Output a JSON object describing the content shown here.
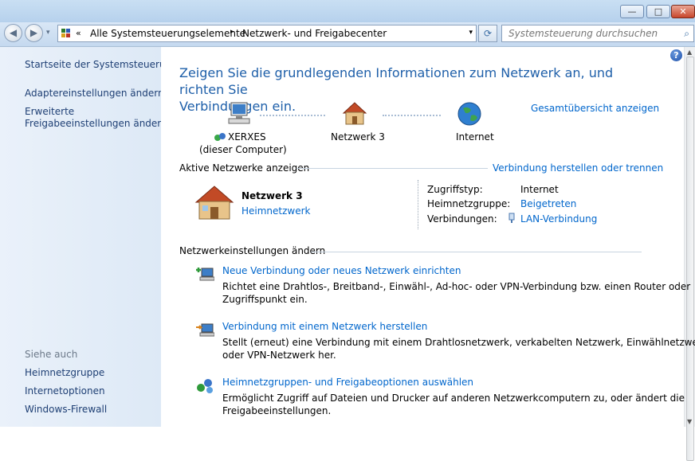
{
  "window": {
    "minimize_glyph": "—",
    "maximize_glyph": "□",
    "close_glyph": "✕"
  },
  "address_bar": {
    "back_glyph": "◀",
    "forward_glyph": "▶",
    "history_glyph": "▾",
    "chevron": "«",
    "separator": "▸",
    "crumbs": [
      "Alle Systemsteuerungselemente",
      "Netzwerk- und Freigabecenter"
    ],
    "dropdown_glyph": "▾",
    "refresh_glyph": "⟳"
  },
  "search": {
    "placeholder": "Systemsteuerung durchsuchen",
    "icon": "⌕"
  },
  "sidebar": {
    "home_link": "Startseite der Systemsteuerung",
    "adapter_link": "Adaptereinstellungen ändern",
    "sharing_link_line1": "Erweiterte",
    "sharing_link_line2": "Freigabeeinstellungen ändern",
    "see_also": "Siehe auch",
    "see_also_links": [
      "Heimnetzgruppe",
      "Internetoptionen",
      "Windows-Firewall"
    ]
  },
  "main": {
    "help_glyph": "?",
    "heading_line1": "Zeigen Sie die grundlegenden Informationen zum Netzwerk an, und richten Sie",
    "heading_line2": "Verbindungen ein.",
    "full_map_link": "Gesamtübersicht anzeigen",
    "map": {
      "computer_name": "XERXES",
      "computer_sub": "(dieser Computer)",
      "network_name": "Netzwerk  3",
      "internet": "Internet"
    },
    "active_networks_label": "Aktive Netzwerke anzeigen",
    "connect_disconnect_link": "Verbindung herstellen oder trennen",
    "network": {
      "name": "Netzwerk  3",
      "type_link": "Heimnetzwerk",
      "access_type_label": "Zugriffstyp:",
      "access_type_value": "Internet",
      "homegroup_label": "Heimnetzgruppe:",
      "homegroup_value": "Beigetreten",
      "connections_label": "Verbindungen:",
      "connections_value": "LAN-Verbindung"
    },
    "change_settings_label": "Netzwerkeinstellungen ändern",
    "tasks": [
      {
        "title": "Neue Verbindung oder neues Netzwerk einrichten",
        "desc_line1": "Richtet eine Drahtlos-, Breitband-, Einwähl-, Ad-hoc- oder VPN-Verbindung bzw. einen Router oder",
        "desc_line2": "Zugriffspunkt ein."
      },
      {
        "title": "Verbindung mit einem Netzwerk herstellen",
        "desc_line1": "Stellt (erneut) eine Verbindung mit einem Drahtlosnetzwerk, verkabelten Netzwerk, Einwählnetzwerk",
        "desc_line2": "oder VPN-Netzwerk her."
      },
      {
        "title": "Heimnetzgruppen- und Freigabeoptionen auswählen",
        "desc_line1": "Ermöglicht Zugriff auf Dateien und Drucker auf anderen Netzwerkcomputern zu, oder ändert die",
        "desc_line2": "Freigabeeinstellungen."
      }
    ]
  },
  "colors": {
    "link": "#0066cc",
    "heading": "#1e5fa9",
    "sidebar_link": "#1e3f74",
    "sidebar_bg": "#dde9f6"
  }
}
